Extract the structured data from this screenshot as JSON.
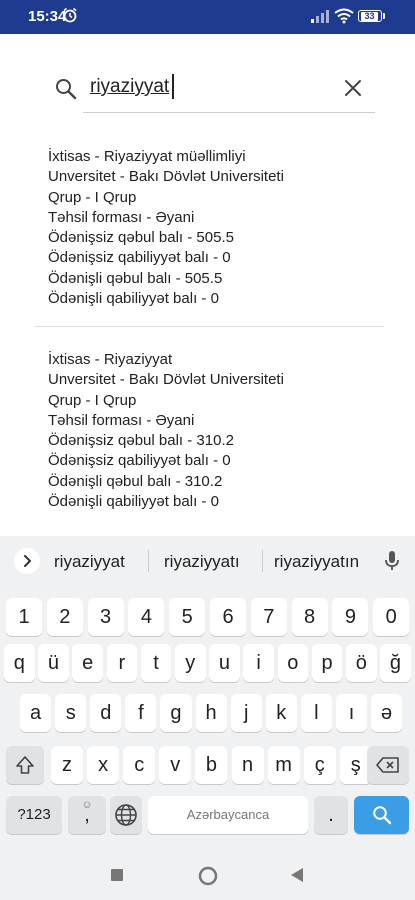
{
  "status_bar": {
    "time": "15:34",
    "battery": "33"
  },
  "search": {
    "query": "riyaziyyat"
  },
  "results": [
    {
      "lines": [
        "İxtisas - Riyaziyyat müəllimliyi",
        "Unversitet - Bakı Dövlət Universiteti",
        "Qrup - I Qrup",
        "Təhsil forması - Əyani",
        "Ödənişsiz qəbul balı - 505.5",
        "Ödənişsiz qabiliyyət balı - 0",
        "Ödənişli qəbul balı - 505.5",
        "Ödənişli qabiliyyət balı - 0"
      ]
    },
    {
      "lines": [
        "İxtisas - Riyaziyyat",
        "Unversitet - Bakı Dövlət Universiteti",
        "Qrup - I Qrup",
        "Təhsil forması - Əyani",
        "Ödənişsiz qəbul balı - 310.2",
        "Ödənişsiz qabiliyyət balı - 0",
        "Ödənişli qəbul balı - 310.2",
        "Ödənişli qabiliyyət balı - 0"
      ]
    }
  ],
  "keyboard": {
    "suggestions": [
      "riyaziyyat",
      "riyaziyyatı",
      "riyaziyyatın"
    ],
    "row_numbers": [
      "1",
      "2",
      "3",
      "4",
      "5",
      "6",
      "7",
      "8",
      "9",
      "0"
    ],
    "row1": [
      "q",
      "ü",
      "e",
      "r",
      "t",
      "y",
      "u",
      "i",
      "o",
      "p",
      "ö",
      "ğ"
    ],
    "row2": [
      "a",
      "s",
      "d",
      "f",
      "g",
      "h",
      "j",
      "k",
      "l",
      "ı",
      "ə"
    ],
    "row3": [
      "z",
      "x",
      "c",
      "v",
      "b",
      "n",
      "m",
      "ç",
      "ş"
    ],
    "symbols_label": "?123",
    "comma_label": ",",
    "period_label": ".",
    "space_label": "Azərbaycanca"
  },
  "colors": {
    "status_bar": "#1f3b8f",
    "enter_key": "#3a9de6"
  }
}
